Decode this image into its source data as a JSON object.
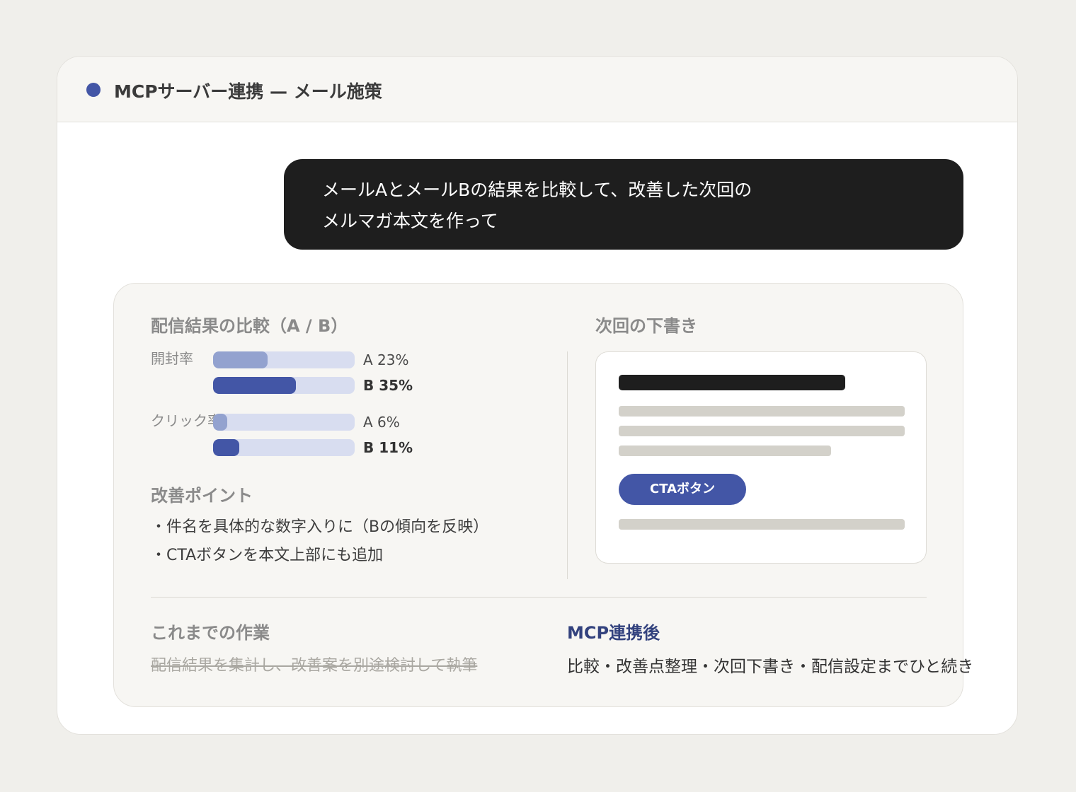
{
  "window": {
    "title": "MCPサーバー連携 — メール施策",
    "accent_color": "#4356a6"
  },
  "prompt": {
    "line1": "メールAとメールBの結果を比較して、改善した次回の",
    "line2": "メルマガ本文を作って"
  },
  "comparison": {
    "heading": "配信結果の比較（A / B）",
    "metrics": [
      {
        "label": "開封率",
        "a": {
          "label": "A 23%",
          "percent": 23
        },
        "b": {
          "label": "B 35%",
          "percent": 35
        }
      },
      {
        "label": "クリック率",
        "a": {
          "label": "A 6%",
          "percent": 6
        },
        "b": {
          "label": "B 11%",
          "percent": 11
        }
      }
    ]
  },
  "improvements": {
    "heading": "改善ポイント",
    "items": [
      "・件名を具体的な数字入りに（Bの傾向を反映）",
      "・CTAボタンを本文上部にも追加"
    ]
  },
  "draft": {
    "heading": "次回の下書き",
    "cta_label": "CTAボタン"
  },
  "before": {
    "heading": "これまでの作業",
    "text": "配信結果を集計し、改善案を別途検討して執筆"
  },
  "after": {
    "heading": "MCP連携後",
    "text": "比較・改善点整理・次回下書き・配信設定までひと続き"
  }
}
